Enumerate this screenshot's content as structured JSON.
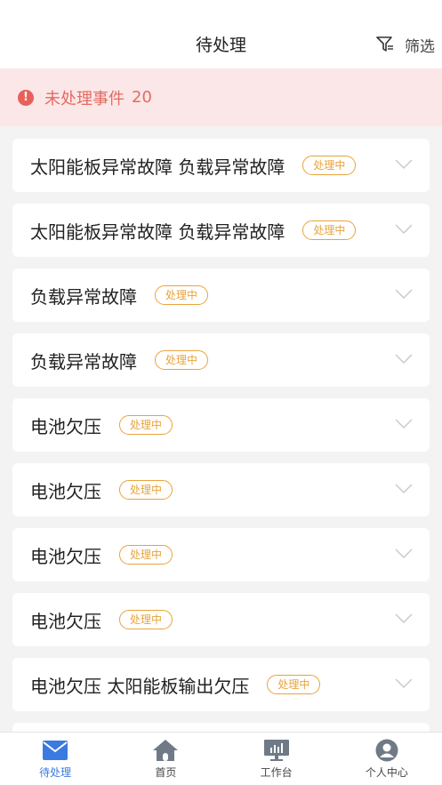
{
  "header": {
    "title": "待处理",
    "filter_label": "筛选"
  },
  "alert": {
    "text": "未处理事件",
    "count": "20"
  },
  "items": [
    {
      "title": "太阳能板异常故障 负载异常故障",
      "status": "处理中"
    },
    {
      "title": "太阳能板异常故障 负载异常故障",
      "status": "处理中"
    },
    {
      "title": "负载异常故障",
      "status": "处理中"
    },
    {
      "title": "负载异常故障",
      "status": "处理中"
    },
    {
      "title": "电池欠压",
      "status": "处理中"
    },
    {
      "title": "电池欠压",
      "status": "处理中"
    },
    {
      "title": "电池欠压",
      "status": "处理中"
    },
    {
      "title": "电池欠压",
      "status": "处理中"
    },
    {
      "title": "电池欠压 太阳能板输出欠压",
      "status": "处理中"
    },
    {
      "title": "",
      "status": ""
    }
  ],
  "tabbar": {
    "tabs": [
      {
        "label": "待处理",
        "icon": "mail-icon",
        "active": true
      },
      {
        "label": "首页",
        "icon": "home-icon",
        "active": false
      },
      {
        "label": "工作台",
        "icon": "monitor-chart-icon",
        "active": false
      },
      {
        "label": "个人中心",
        "icon": "user-icon",
        "active": false
      }
    ]
  },
  "colors": {
    "accent": "#3b7ae0",
    "badge": "#e8a33b",
    "alert_bg": "#fbe7e7",
    "alert_text": "#e56a61"
  }
}
